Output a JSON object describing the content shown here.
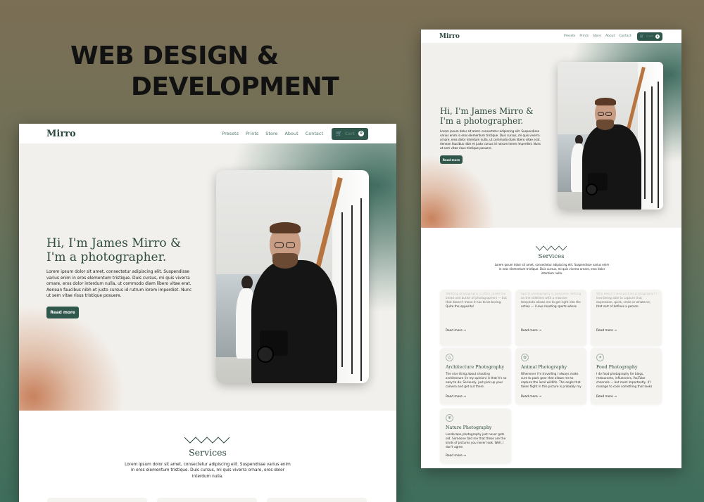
{
  "banner": {
    "line1": "WEB DESIGN &",
    "line2": "DEVELOPMENT"
  },
  "site": {
    "logo": "Mirro",
    "nav": [
      "Presets",
      "Prints",
      "Store",
      "About",
      "Contact"
    ],
    "cart_label": "Cart",
    "cart_count": "0",
    "hero": {
      "title_line1": "Hi, I'm James Mirro &",
      "title_line2": "I'm a photographer.",
      "text": "Lorem ipsum dolor sit amet, consectetur adipiscing elit. Suspendisse varius enim in eros elementum tristique. Duis cursus, mi quis viverra ornare, eros dolor interdum nulla, ut commodo diam libero vitae erat. Aenean faucibus nibh et justo cursus id rutrum lorem imperdiet. Nunc ut sem vitae risus tristique posuere.",
      "button": "Read more"
    },
    "services": {
      "title": "Services",
      "text": "Lorem ipsum dolor sit amet, consectetur adipiscing elit. Suspendisse varius enim in eros elementum tristique. Duis cursus, mi quis viverra ornare, eros dolor interdum nulla."
    },
    "cards_top": [
      {
        "text": "Wedding photography is often called the bread and butter of photographers — but that doesn't mean it has to be boring. Quite the opposite!",
        "more": "Read more →"
      },
      {
        "text": "Sports photography is awesome. Setting on the sidelines with a massive telephoto allows me to get right into the action — I love shooting sports where there's a lot of explosive movement.",
        "more": "Read more →"
      },
      {
        "text": "Who doesn't love portrait photography? I love being able to capture that expression, quirk, smile or whatever, that sort of defines a person.",
        "more": "Read more →"
      }
    ],
    "cards": [
      {
        "icon": "⌂",
        "title": "Architecture Photography",
        "text": "The nice thing about shooting architecture (in my opinion) is that it's so easy to do. Seriously, just pick up your camera and get out there.",
        "more": "Read more →"
      },
      {
        "icon": "✿",
        "title": "Animal Photography",
        "text": "Whenever I'm travelling I always make sure to pack gear that allows me to capture the local wildlife. The angle that takes flight in this picture is probably my most prized image.",
        "more": "Read more →"
      },
      {
        "icon": "✦",
        "title": "Food Photography",
        "text": "I do food photography for blogs, restaurants, influencers, YouTube channels — but most importantly, if I manage to cook something that looks good! — I do food photography for myself!",
        "more": "Read more →"
      },
      {
        "icon": "❦",
        "title": "Nature Photography",
        "text": "Landscape photography just never gets old. Someone told me that these are the kinds of pictures you never look. Well, I don't agree.",
        "more": "Read more →"
      }
    ]
  },
  "colors": {
    "brand": "#30574b",
    "title": "#2d4a3f",
    "peach": "#c67c56"
  }
}
